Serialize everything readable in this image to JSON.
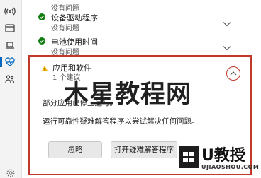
{
  "items": [
    {
      "title": "设备驱动程序",
      "status": "没有问题"
    },
    {
      "title": "电池使用时间",
      "status": "没有问题"
    }
  ],
  "top_partial_status": "没有问题",
  "panel": {
    "title": "应用和软件",
    "count": "1 个建议",
    "line1": "部分应用已停止运行。",
    "line2": "运行可靠性疑难解答程序以尝试解决任何问题。",
    "ignore_label": "忽略",
    "run_label": "打开疑难解答程序"
  },
  "watermark": "木星教程网",
  "logo": {
    "text": "U教授",
    "url": "UJIAOSHOU.COM"
  },
  "colors": {
    "accent": "#0067c0",
    "ok": "#107c10",
    "highlight": "#c0392b",
    "warn": "#f2b600"
  }
}
